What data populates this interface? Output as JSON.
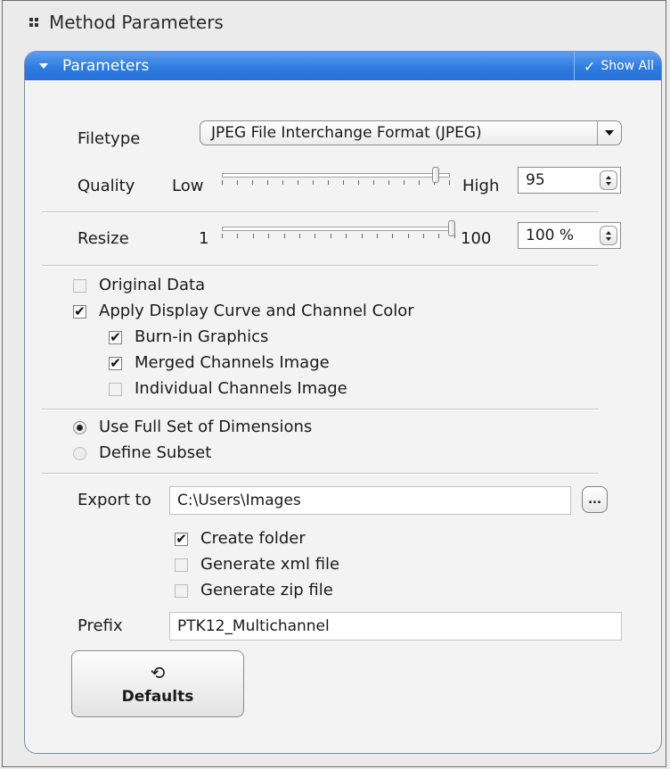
{
  "header": {
    "title": "Method Parameters"
  },
  "panel": {
    "title": "Parameters",
    "show_all_label": "Show All"
  },
  "filetype": {
    "label": "Filetype",
    "value": "JPEG File Interchange Format (JPEG)"
  },
  "quality": {
    "label": "Quality",
    "low_label": "Low",
    "high_label": "High",
    "value": "95",
    "slider_fraction": 0.95
  },
  "resize": {
    "label": "Resize",
    "min_label": "1",
    "max_label": "100",
    "value": "100 %",
    "slider_fraction": 1.0
  },
  "options": {
    "original_data": {
      "label": "Original Data",
      "checked": false
    },
    "apply_display_curve": {
      "label": "Apply Display Curve and Channel Color",
      "checked": true
    },
    "burn_in_graphics": {
      "label": "Burn-in Graphics",
      "checked": true
    },
    "merged_channels": {
      "label": "Merged Channels Image",
      "checked": true
    },
    "individual_channels": {
      "label": "Individual Channels Image",
      "checked": false
    }
  },
  "dimensions": {
    "full_set": {
      "label": "Use Full Set of Dimensions",
      "selected": true
    },
    "subset": {
      "label": "Define Subset",
      "selected": false
    }
  },
  "export": {
    "label": "Export to",
    "path": "C:\\Users\\Images",
    "browse_label": "...",
    "create_folder": {
      "label": "Create folder",
      "checked": true
    },
    "generate_xml": {
      "label": "Generate xml file",
      "checked": false
    },
    "generate_zip": {
      "label": "Generate zip file",
      "checked": false
    }
  },
  "prefix": {
    "label": "Prefix",
    "value": "PTK12_Multichannel"
  },
  "defaults_button": {
    "label": "Defaults",
    "icon": "undo-icon"
  }
}
